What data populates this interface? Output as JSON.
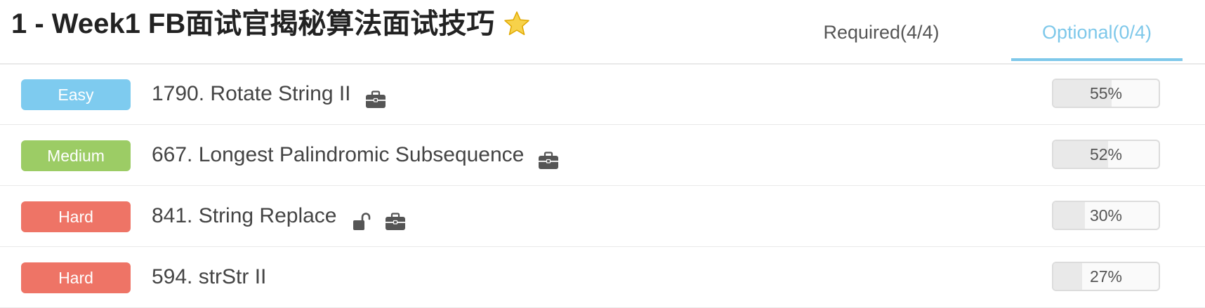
{
  "header": {
    "title": "1 - Week1 FB面试官揭秘算法面试技巧",
    "tabs": [
      {
        "label": "Required(4/4)",
        "active": false
      },
      {
        "label": "Optional(0/4)",
        "active": true
      }
    ]
  },
  "colors": {
    "easy": "#7ecbef",
    "medium": "#9ccc65",
    "hard": "#ee7466",
    "accent": "#7ec8ea"
  },
  "problems": [
    {
      "difficulty": "Easy",
      "name": "1790. Rotate String II",
      "icons": [
        "briefcase-icon"
      ],
      "rate": 0.55,
      "rate_label": "55%"
    },
    {
      "difficulty": "Medium",
      "name": "667. Longest Palindromic Subsequence",
      "icons": [
        "briefcase-icon"
      ],
      "rate": 0.52,
      "rate_label": "52%"
    },
    {
      "difficulty": "Hard",
      "name": "841. String Replace",
      "icons": [
        "unlock-icon",
        "briefcase-icon"
      ],
      "rate": 0.3,
      "rate_label": "30%"
    },
    {
      "difficulty": "Hard",
      "name": "594. strStr II",
      "icons": [],
      "rate": 0.27,
      "rate_label": "27%"
    }
  ]
}
